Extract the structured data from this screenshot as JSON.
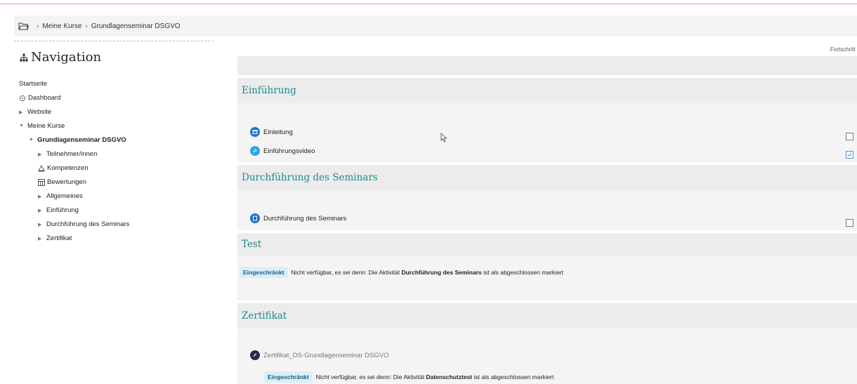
{
  "breadcrumb": {
    "items": [
      "Meine Kurse",
      "Grundlagenseminar DSGVO"
    ],
    "separator": "›"
  },
  "navigation": {
    "title": "Navigation",
    "items": [
      {
        "label": "Startseite"
      },
      {
        "label": "Dashboard"
      },
      {
        "label": "Website"
      },
      {
        "label": "Meine Kurse"
      },
      {
        "label": "Grundlagenseminar DSGVO"
      },
      {
        "label": "Teilnehmer/innen"
      },
      {
        "label": "Kompetenzen"
      },
      {
        "label": "Bewertungen"
      },
      {
        "label": "Allgemeines"
      },
      {
        "label": "Einführung"
      },
      {
        "label": "Durchführung des Seminars"
      },
      {
        "label": "Zertifikat"
      }
    ]
  },
  "course": {
    "progress_label": "Fortschritt",
    "sections": [
      {
        "title": "Einführung",
        "activities": [
          {
            "label": "Einleitung",
            "completed": false
          },
          {
            "label": "Einführungsvideo",
            "completed": true
          }
        ]
      },
      {
        "title": "Durchführung des Seminars",
        "activities": [
          {
            "label": "Durchführung des Seminars",
            "completed": false
          }
        ]
      },
      {
        "title": "Test",
        "restriction": {
          "badge": "Eingeschränkt",
          "prefix": "Nicht verfügbar, es sei denn: Die Aktivität",
          "activity": "Durchführung des Seminars",
          "suffix": "ist als abgeschlossen markiert"
        }
      },
      {
        "title": "Zertifikat",
        "activities": [
          {
            "label": "Zertifikat_DS-Grundlagenseminar DSGVO"
          }
        ],
        "restriction": {
          "badge": "Eingeschränkt",
          "prefix": "Nicht verfügbar, es sei denn: Die Aktivität",
          "activity": "Datenschutztest",
          "suffix": "ist als abgeschlossen markiert"
        }
      }
    ]
  },
  "colors": {
    "accent": "#1b8a8a",
    "topline": "#f0a47a",
    "badge_bg": "#dbeef7",
    "badge_text": "#1b5d8a",
    "icon_blue": "#1a73c7"
  }
}
